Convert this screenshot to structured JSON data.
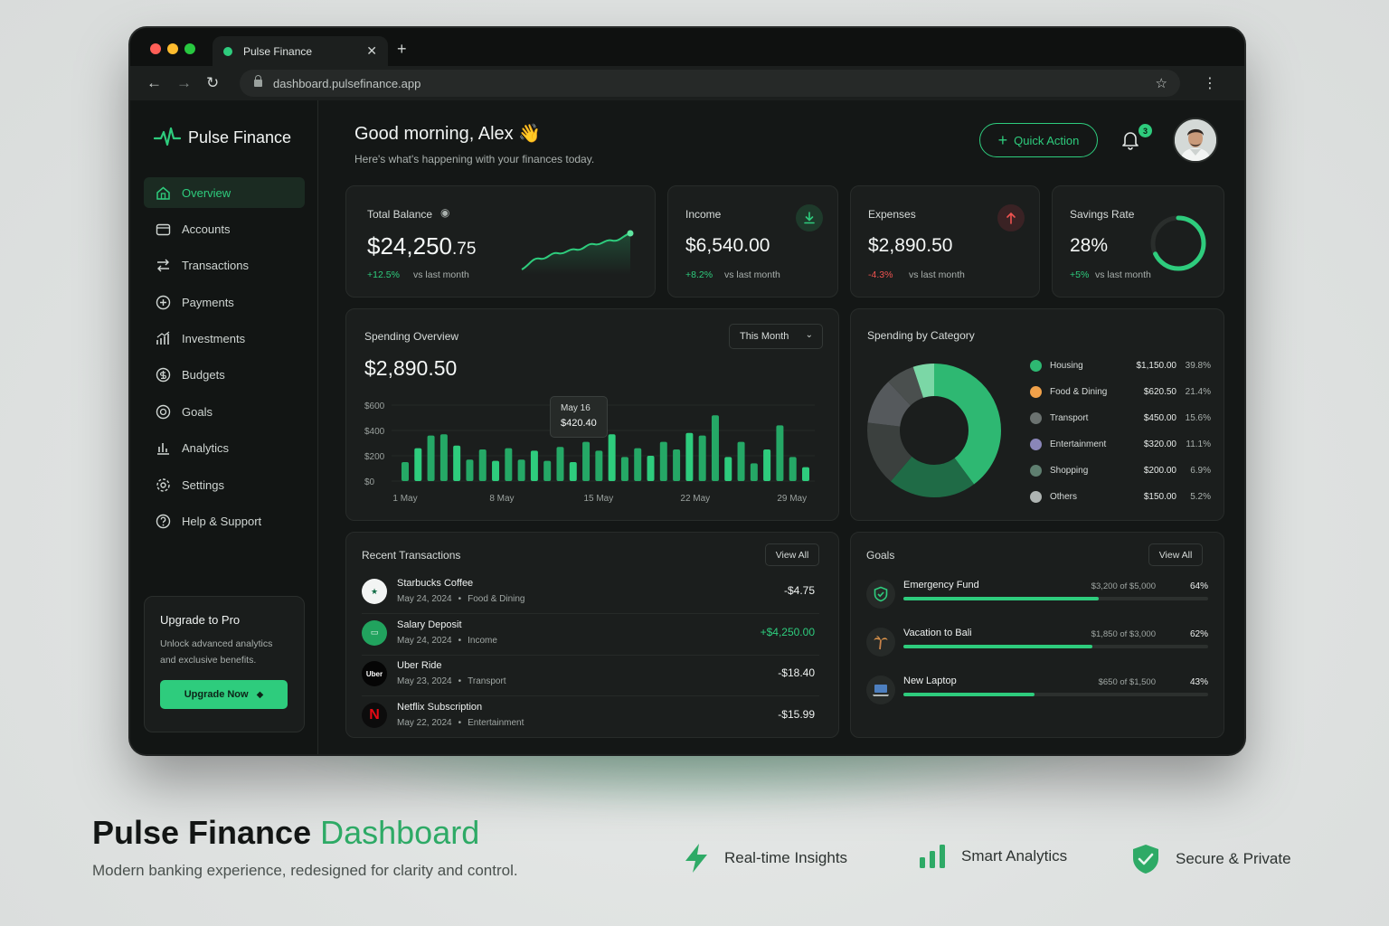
{
  "browser": {
    "tab_title": "Pulse Finance",
    "url": "dashboard.pulsefinance.app"
  },
  "brand": {
    "name": "Pulse Finance",
    "accent": "#2ecc7d"
  },
  "sidebar": {
    "items": [
      {
        "label": "Overview",
        "icon": "home-icon",
        "active": true
      },
      {
        "label": "Accounts",
        "icon": "wallet-icon"
      },
      {
        "label": "Transactions",
        "icon": "transfer-icon"
      },
      {
        "label": "Payments",
        "icon": "plus-circle-icon"
      },
      {
        "label": "Investments",
        "icon": "chart-up-icon"
      },
      {
        "label": "Budgets",
        "icon": "coin-icon"
      },
      {
        "label": "Goals",
        "icon": "target-icon"
      },
      {
        "label": "Analytics",
        "icon": "bar-chart-icon"
      },
      {
        "label": "Settings",
        "icon": "gear-icon"
      },
      {
        "label": "Help & Support",
        "icon": "help-icon"
      }
    ],
    "upgrade": {
      "title": "Upgrade to Pro",
      "text": "Unlock advanced analytics and exclusive benefits.",
      "button": "Upgrade Now"
    }
  },
  "header": {
    "greeting": "Good morning, Alex 👋",
    "subtitle": "Here's what's happening with your finances today.",
    "quick_action": "Quick Action",
    "notifications": "3"
  },
  "stats": {
    "balance": {
      "label": "Total Balance",
      "value_main": "$24,250",
      "value_cents": ".75",
      "delta": "+12.5%",
      "compare": "vs last month"
    },
    "income": {
      "label": "Income",
      "value": "$6,540.00",
      "delta": "+8.2%",
      "compare": "vs last month"
    },
    "expenses": {
      "label": "Expenses",
      "value": "$2,890.50",
      "delta": "-4.3%",
      "compare": "vs last month"
    },
    "savings": {
      "label": "Savings Rate",
      "value": "28%",
      "delta": "+5%",
      "compare": "vs last month",
      "rate": 0.28
    }
  },
  "spending": {
    "title": "Spending Overview",
    "period": "This Month",
    "total": "$2,890.50",
    "tooltip": {
      "date": "May 16",
      "value": "$420.40"
    }
  },
  "chart_data": {
    "type": "bar",
    "yticks": [
      "$600",
      "$400",
      "$200",
      "$0"
    ],
    "ylim": [
      0,
      600
    ],
    "xtick_labels": [
      "1 May",
      "8 May",
      "15 May",
      "22 May",
      "29 May"
    ],
    "xtick_days": [
      1,
      8,
      15,
      22,
      29
    ],
    "days": [
      1,
      2,
      3,
      4,
      5,
      6,
      7,
      8,
      9,
      10,
      11,
      12,
      13,
      14,
      15,
      16,
      17,
      18,
      19,
      20,
      21,
      22,
      23,
      24,
      25,
      26,
      27,
      28,
      29,
      30
    ],
    "values": [
      150,
      260,
      360,
      370,
      280,
      170,
      250,
      160,
      260,
      170,
      240,
      160,
      270,
      150,
      310,
      240,
      370,
      190,
      260,
      200,
      310,
      250,
      380,
      360,
      520,
      190,
      310,
      140,
      250,
      440,
      190,
      110
    ]
  },
  "category": {
    "title": "Spending by Category",
    "items": [
      {
        "name": "Housing",
        "amount": "$1,150.00",
        "pct": "39.8%",
        "value": 39.8,
        "color": "#2eb872"
      },
      {
        "name": "Food & Dining",
        "amount": "$620.50",
        "pct": "21.4%",
        "value": 21.4,
        "color": "#f0a14a"
      },
      {
        "name": "Transport",
        "amount": "$450.00",
        "pct": "15.6%",
        "value": 15.6,
        "color": "#6b7270"
      },
      {
        "name": "Entertainment",
        "amount": "$320.00",
        "pct": "11.1%",
        "value": 11.1,
        "color": "#8a86b8"
      },
      {
        "name": "Shopping",
        "amount": "$200.00",
        "pct": "6.9%",
        "value": 6.9,
        "color": "#5f7f70"
      },
      {
        "name": "Others",
        "amount": "$150.00",
        "pct": "5.2%",
        "value": 5.2,
        "color": "#aeb4b2"
      }
    ]
  },
  "transactions": {
    "title": "Recent Transactions",
    "view_all": "View All",
    "items": [
      {
        "name": "Starbucks Coffee",
        "date": "May 24, 2024",
        "category": "Food & Dining",
        "amount": "-$4.75",
        "icon": "starbucks-icon",
        "color": "#eef1f0"
      },
      {
        "name": "Salary Deposit",
        "date": "May 24, 2024",
        "category": "Income",
        "amount": "+$4,250.00",
        "icon": "wallet-icon",
        "color": "#2ecc7d"
      },
      {
        "name": "Uber Ride",
        "date": "May 23, 2024",
        "category": "Transport",
        "amount": "-$18.40",
        "icon": "uber-icon",
        "color": "#eef1f0"
      },
      {
        "name": "Netflix Subscription",
        "date": "May 22, 2024",
        "category": "Entertainment",
        "amount": "-$15.99",
        "icon": "netflix-icon",
        "color": "#eef1f0"
      }
    ]
  },
  "goals": {
    "title": "Goals",
    "view_all": "View All",
    "items": [
      {
        "name": "Emergency Fund",
        "progress_text": "$3,200 of $5,000",
        "pct": "64%",
        "ratio": 0.64,
        "icon": "shield-icon"
      },
      {
        "name": "Vacation to Bali",
        "progress_text": "$1,850 of $3,000",
        "pct": "62%",
        "ratio": 0.62,
        "icon": "palm-tree-icon"
      },
      {
        "name": "New Laptop",
        "progress_text": "$650 of $1,500",
        "pct": "43%",
        "ratio": 0.43,
        "icon": "laptop-icon"
      }
    ]
  },
  "hero": {
    "title_main": "Pulse Finance",
    "title_accent": "Dashboard",
    "subtitle": "Modern banking experience, redesigned for clarity and control.",
    "features": [
      "Real-time Insights",
      "Smart Analytics",
      "Secure & Private"
    ]
  }
}
